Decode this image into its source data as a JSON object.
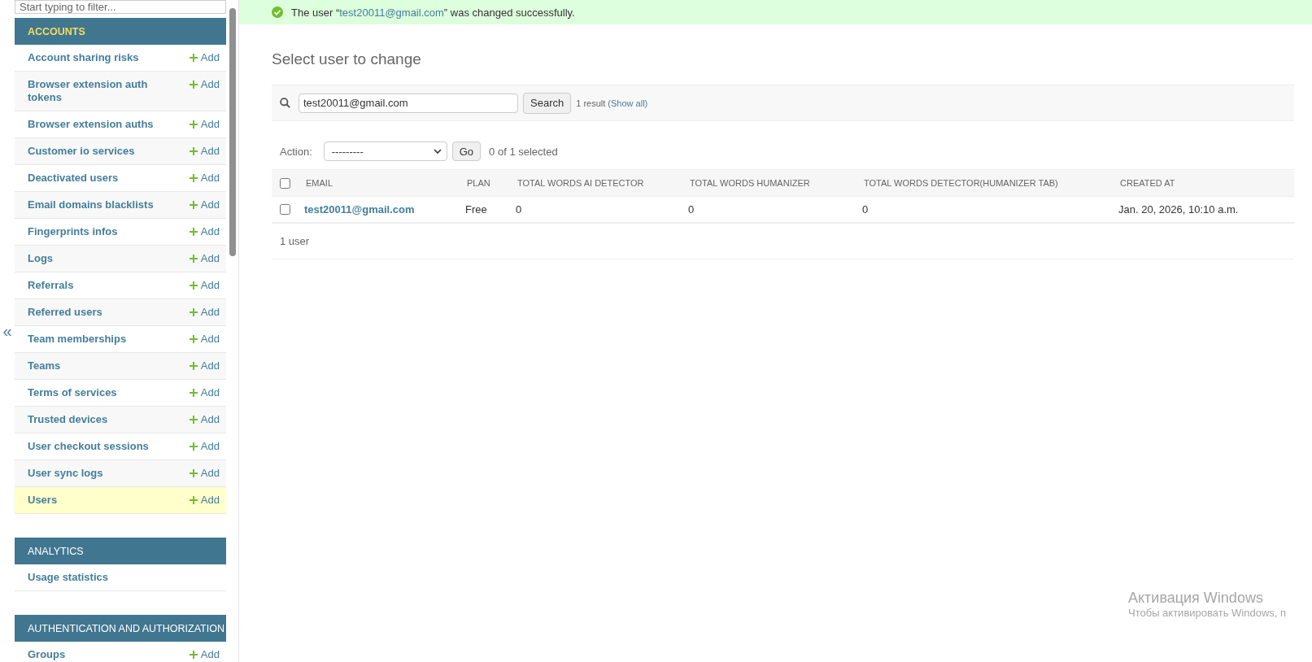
{
  "sidebar": {
    "filter": {
      "placeholder": "Start typing to filter..."
    },
    "collapse_toggle": "«",
    "sections": [
      {
        "title": "ACCOUNTS",
        "current": true,
        "models": [
          {
            "name": "Account sharing risks",
            "add": "Add",
            "selected": false
          },
          {
            "name": "Browser extension auth tokens",
            "add": "Add",
            "selected": false
          },
          {
            "name": "Browser extension auths",
            "add": "Add",
            "selected": false
          },
          {
            "name": "Customer io services",
            "add": "Add",
            "selected": false
          },
          {
            "name": "Deactivated users",
            "add": "Add",
            "selected": false
          },
          {
            "name": "Email domains blacklists",
            "add": "Add",
            "selected": false
          },
          {
            "name": "Fingerprints infos",
            "add": "Add",
            "selected": false
          },
          {
            "name": "Logs",
            "add": "Add",
            "selected": false
          },
          {
            "name": "Referrals",
            "add": "Add",
            "selected": false
          },
          {
            "name": "Referred users",
            "add": "Add",
            "selected": false
          },
          {
            "name": "Team memberships",
            "add": "Add",
            "selected": false
          },
          {
            "name": "Teams",
            "add": "Add",
            "selected": false
          },
          {
            "name": "Terms of services",
            "add": "Add",
            "selected": false
          },
          {
            "name": "Trusted devices",
            "add": "Add",
            "selected": false
          },
          {
            "name": "User checkout sessions",
            "add": "Add",
            "selected": false
          },
          {
            "name": "User sync logs",
            "add": "Add",
            "selected": false
          },
          {
            "name": "Users",
            "add": "Add",
            "selected": true
          }
        ]
      },
      {
        "title": "ANALYTICS",
        "current": false,
        "models": [
          {
            "name": "Usage statistics",
            "selected": false
          }
        ]
      },
      {
        "title": "AUTHENTICATION AND AUTHORIZATION",
        "current": false,
        "models": [
          {
            "name": "Groups",
            "add": "Add",
            "selected": false
          }
        ]
      }
    ]
  },
  "message": {
    "before": "The user “",
    "link": "test20011@gmail.com",
    "after": "” was changed successfully."
  },
  "title": "Select user to change",
  "search": {
    "value": "test20011@gmail.com",
    "button": "Search",
    "result": "1 result",
    "show_all": "(Show all)"
  },
  "actions": {
    "label": "Action:",
    "selected_option": "---------",
    "go": "Go",
    "counter": "0 of 1 selected"
  },
  "table": {
    "select_all_checked": false,
    "columns": [
      "EMAIL",
      "PLAN",
      "TOTAL WORDS AI DETECTOR",
      "TOTAL WORDS HUMANIZER",
      "TOTAL WORDS DETECTOR(HUMANIZER TAB)",
      "CREATED AT"
    ],
    "rows": [
      {
        "checked": false,
        "cells": [
          "test20011@gmail.com",
          "Free",
          "0",
          "0",
          "0",
          "Jan. 20, 2026, 10:10 a.m."
        ]
      }
    ]
  },
  "paginator": "1 user",
  "os_watermark": {
    "title": "Активация Windows",
    "text": "Чтобы активировать Windows, п"
  }
}
